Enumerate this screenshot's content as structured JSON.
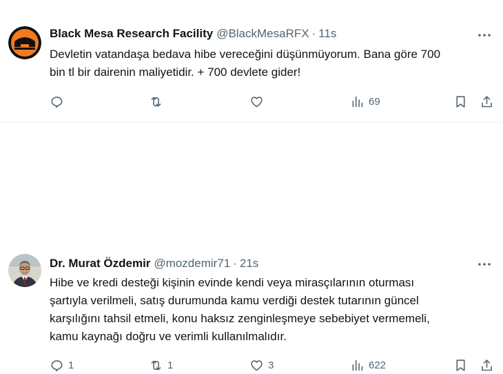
{
  "tweets": [
    {
      "author": "Black Mesa Research Facility",
      "handle": "@BlackMesaRFX",
      "separator": "·",
      "time": "11s",
      "avatar_icon": "black-mesa-logo",
      "lines": [
        "Devletin vatandaşa bedava hibe vereceğini düşünmüyorum. Bana göre 700",
        "bin tl bir dairenin maliyetidir. + 700 devlete gider!"
      ],
      "reply_count": "",
      "retweet_count": "",
      "like_count": "",
      "view_count": "69"
    },
    {
      "author": "Dr. Murat Özdemir",
      "handle": "@mozdemir71",
      "separator": "·",
      "time": "21s",
      "avatar_icon": "profile-photo",
      "lines": [
        "Hibe ve kredi desteği kişinin evinde kendi veya mirasçılarının oturması",
        "şartıyla verilmeli, satış durumunda kamu verdiği destek tutarının güncel",
        "karşılığını tahsil etmeli, konu haksız zenginleşmeye sebebiyet vermemeli,",
        "kamu kaynağı doğru ve verimli kullanılmalıdır."
      ],
      "reply_count": "1",
      "retweet_count": "1",
      "like_count": "3",
      "view_count": "622"
    }
  ],
  "colors": {
    "text": "#0f1419",
    "secondary": "#536471",
    "divider": "#eff3f4",
    "logo_orange": "#f47a1f"
  }
}
